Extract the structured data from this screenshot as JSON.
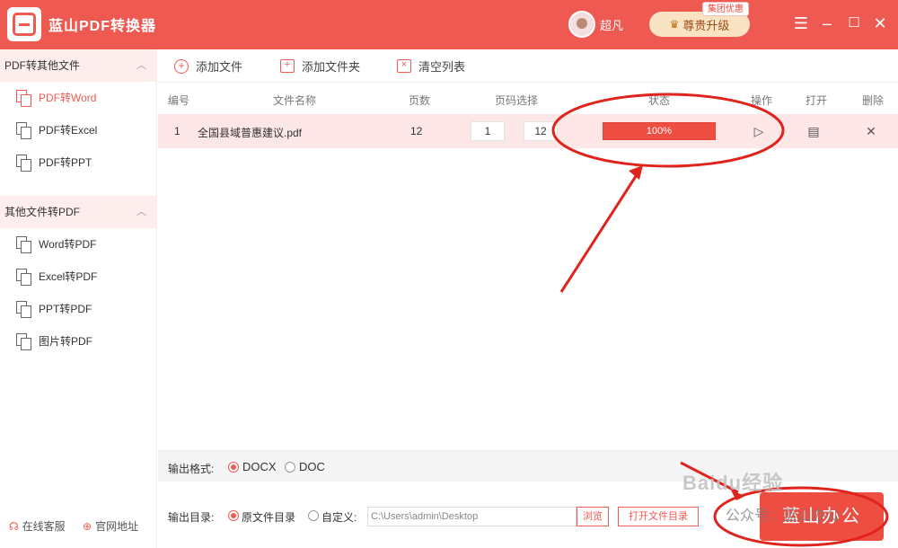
{
  "titlebar": {
    "app_name": "蓝山PDF转换器",
    "username": "超凡",
    "upgrade_label": "尊贵升级",
    "group_badge": "集团优惠",
    "min_icon": "minimize-icon",
    "max_icon": "maximize-icon",
    "close_icon": "close-icon",
    "menu_icon": "menu-icon"
  },
  "sidebar": {
    "section1": "PDF转其他文件",
    "items1": [
      {
        "label": "PDF转Word",
        "active": true
      },
      {
        "label": "PDF转Excel",
        "active": false
      },
      {
        "label": "PDF转PPT",
        "active": false
      }
    ],
    "section2": "其他文件转PDF",
    "items2": [
      {
        "label": "Word转PDF"
      },
      {
        "label": "Excel转PDF"
      },
      {
        "label": "PPT转PDF"
      },
      {
        "label": "图片转PDF"
      }
    ],
    "support": "在线客服",
    "official_site": "官网地址"
  },
  "toolbar": {
    "add_file": "添加文件",
    "add_folder": "添加文件夹",
    "clear_list": "清空列表"
  },
  "table": {
    "headers": [
      "编号",
      "文件名称",
      "页数",
      "页码选择",
      "状态",
      "操作",
      "打开",
      "删除"
    ],
    "rows": [
      {
        "index": "1",
        "filename": "全国县域普惠建议.pdf",
        "pages": "12",
        "from": "1",
        "to": "12",
        "progress_text": "100%",
        "progress": 1.0
      }
    ]
  },
  "output": {
    "format_label": "输出格式:",
    "format_options": [
      "DOCX",
      "DOC"
    ],
    "format_selected": "DOCX",
    "dir_label": "输出目录:",
    "dir_option_original": "原文件目录",
    "dir_option_custom": "自定义:",
    "dir_path": "C:\\Users\\admin\\Desktop",
    "browse": "浏览",
    "open_folder": "打开文件目录"
  },
  "convert_button": "蓝山办公",
  "watermark": "Baidu经验",
  "watermark_sub": "公众号：蓝山办公",
  "colors": {
    "brand": "#ee5a52",
    "annotation": "#e0231c"
  }
}
